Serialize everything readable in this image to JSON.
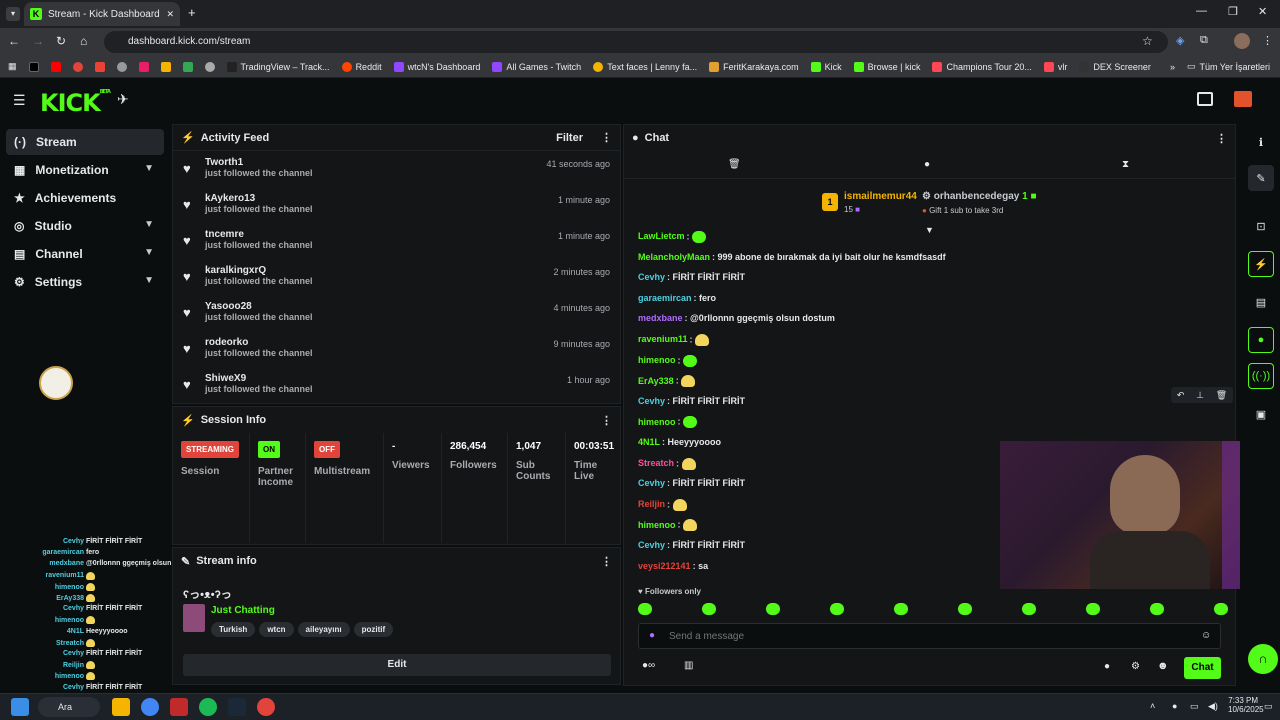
{
  "browser": {
    "tab_title": "Stream - Kick Dashboard",
    "url": "dashboard.kick.com/stream",
    "bookmarks": [
      "TradingView – Track...",
      "Reddit",
      "wtcN's Dashboard",
      "All Games - Twitch",
      "Text faces | Lenny fa...",
      "FeritKarakaya.com",
      "Kick",
      "Browse | kick",
      "Champions Tour 20...",
      "vlr",
      "DEX Screener"
    ],
    "all_bookmarks": "Tüm Yer İşaretleri"
  },
  "kick": {
    "logo": "KICK",
    "beta": "BETA"
  },
  "nav": [
    {
      "label": "Stream",
      "icon": "stream-icon",
      "active": true
    },
    {
      "label": "Monetization",
      "icon": "monetization-icon"
    },
    {
      "label": "Achievements",
      "icon": "achievements-icon"
    },
    {
      "label": "Studio",
      "icon": "studio-icon"
    },
    {
      "label": "Channel",
      "icon": "channel-icon"
    },
    {
      "label": "Settings",
      "icon": "settings-icon"
    }
  ],
  "activity": {
    "title": "Activity Feed",
    "filter": "Filter",
    "items": [
      {
        "name": "Tworth1",
        "action": "just followed the channel",
        "time": "41 seconds ago"
      },
      {
        "name": "kAykero13",
        "action": "just followed the channel",
        "time": "1 minute ago"
      },
      {
        "name": "tncemre",
        "action": "just followed the channel",
        "time": "1 minute ago"
      },
      {
        "name": "karalkingxrQ",
        "action": "just followed the channel",
        "time": "2 minutes ago"
      },
      {
        "name": "Yasooo28",
        "action": "just followed the channel",
        "time": "4 minutes ago"
      },
      {
        "name": "rodeorko",
        "action": "just followed the channel",
        "time": "9 minutes ago"
      },
      {
        "name": "ShiweX9",
        "action": "just followed the channel",
        "time": "1 hour ago"
      }
    ]
  },
  "session": {
    "title": "Session Info",
    "streaming_badge": "STREAMING",
    "session_label": "Session",
    "on_badge": "ON",
    "partner_label": "Partner Income",
    "off_badge": "OFF",
    "multistream_label": "Multistream",
    "viewers_value": "-",
    "viewers_label": "Viewers",
    "followers_value": "286,454",
    "followers_label": "Followers",
    "subs_value": "1,047",
    "subs_label": "Sub Counts",
    "time_value": "00:03:51",
    "time_label": "Time Live"
  },
  "streaminfo": {
    "title": "Stream info",
    "stream_title": "ʕっ•ᴥ•ʔっ",
    "category": "Just Chatting",
    "tags": [
      "Turkish",
      "wtcn",
      "aileyayını",
      "pozitif"
    ],
    "edit": "Edit"
  },
  "chat": {
    "title": "Chat",
    "top_gifter_rank": "1",
    "top_gifter": "ismailmemur44",
    "top_gifter_count": "15",
    "second_gifter": "orhanbencedegay",
    "second_count": "1",
    "gift_prompt": "Gift 1 sub to take 3rd",
    "messages": [
      {
        "user": "LawLietcm",
        "color": "#53fc18",
        "text": ""
      },
      {
        "user": "MelancholyMaan",
        "color": "#53fc18",
        "text": "999 abone de bırakmak da iyi bait olur he ksmdfsasdf"
      },
      {
        "user": "Cevhy",
        "color": "#4dd0e1",
        "text": "FİRİT FİRİT FİRİT"
      },
      {
        "user": "garaemircan",
        "color": "#4dd0e1",
        "text": "fero"
      },
      {
        "user": "medxbane",
        "color": "#b06cff",
        "text": "@0rllonnn ggeçmiş olsun dostum"
      },
      {
        "user": "ravenium11",
        "color": "#53fc18",
        "text": ""
      },
      {
        "user": "himenoo",
        "color": "#53fc18",
        "text": ""
      },
      {
        "user": "ErAy338",
        "color": "#53fc18",
        "text": ""
      },
      {
        "user": "Cevhy",
        "color": "#4dd0e1",
        "text": "FİRİT FİRİT FİRİT"
      },
      {
        "user": "himenoo",
        "color": "#53fc18",
        "text": ""
      },
      {
        "user": "4N1L",
        "color": "#53fc18",
        "text": "Heeyyyoooo"
      },
      {
        "user": "Streatch",
        "color": "#ff4f9a",
        "text": ""
      },
      {
        "user": "Cevhy",
        "color": "#4dd0e1",
        "text": "FİRİT FİRİT FİRİT"
      },
      {
        "user": "Reiljin",
        "color": "#e0443a",
        "text": ""
      },
      {
        "user": "himenoo",
        "color": "#53fc18",
        "text": ""
      },
      {
        "user": "Cevhy",
        "color": "#4dd0e1",
        "text": "FİRİT FİRİT FİRİT"
      },
      {
        "user": "veysi212141",
        "color": "#e0443a",
        "text": "sa"
      }
    ],
    "followers_only": "Followers only",
    "placeholder": "Send a message",
    "send": "Chat"
  },
  "overlay": {
    "lines": [
      {
        "user": "Cevhy",
        "text": "FİRİT FİRİT FİRİT"
      },
      {
        "user": "garaemircan",
        "text": "fero"
      },
      {
        "user": "medxbane",
        "text": "@0rllonnn ggeçmiş olsun dostum"
      },
      {
        "user": "ravenium11",
        "text": ""
      },
      {
        "user": "himenoo",
        "text": ""
      },
      {
        "user": "ErAy338",
        "text": ""
      },
      {
        "user": "Cevhy",
        "text": "FİRİT FİRİT FİRİT"
      },
      {
        "user": "himenoo",
        "text": ""
      },
      {
        "user": "4N1L",
        "text": "Heeyyyoooo"
      },
      {
        "user": "Streatch",
        "text": ""
      },
      {
        "user": "Cevhy",
        "text": "FİRİT FİRİT FİRİT"
      },
      {
        "user": "Reiljin",
        "text": ""
      },
      {
        "user": "himenoo",
        "text": ""
      },
      {
        "user": "Cevhy",
        "text": "FİRİT FİRİT FİRİT"
      }
    ]
  },
  "taskbar": {
    "search": "Ara",
    "time": "7:33 PM",
    "date": "10/6/2025"
  },
  "colors": {
    "accent": "#53fc18",
    "streaming": "#e0443a",
    "on": "#53fc18"
  }
}
